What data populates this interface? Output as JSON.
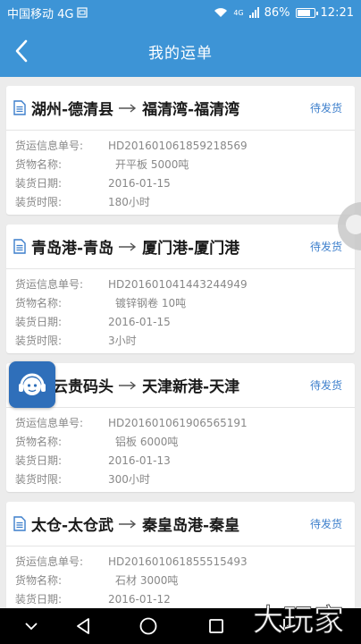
{
  "status_bar": {
    "carrier": "中国移动 4G",
    "network_type": "4G",
    "battery": "86%",
    "battery_level": 0.86,
    "time": "12:21"
  },
  "header": {
    "title": "我的运单"
  },
  "labels": {
    "order_no": "货运信息单号:",
    "goods_name": "货物名称:",
    "load_date": "装货日期:",
    "load_time_limit": "装货时限:"
  },
  "orders": [
    {
      "from": "湖州-德清县",
      "to": "福清湾-福清湾",
      "status": "待发货",
      "order_no": "HD201601061859218569",
      "goods": "开平板 5000吨",
      "load_date": "2016-01-15",
      "time_limit": "180小时"
    },
    {
      "from": "青岛港-青岛",
      "to": "厦门港-厦门港",
      "status": "待发货",
      "order_no": "HD201601041443244949",
      "goods": "镀锌钢卷 10吨",
      "load_date": "2016-01-15",
      "time_limit": "3小时"
    },
    {
      "from": "陵-云贵码头",
      "to": "天津新港-天津",
      "status": "待发货",
      "order_no": "HD201601061906565191",
      "goods": "铝板 6000吨",
      "load_date": "2016-01-13",
      "time_limit": "300小时"
    },
    {
      "from": "太仓-太仓武",
      "to": "秦皇岛港-秦皇",
      "status": "待发货",
      "order_no": "HD201601061855515493",
      "goods": "石材 3000吨",
      "load_date": "2016-01-12",
      "time_limit": ""
    }
  ],
  "watermark": "大玩家",
  "colors": {
    "primary": "#3d94d6",
    "status_text": "#3d7fcc",
    "background": "#ececec"
  }
}
